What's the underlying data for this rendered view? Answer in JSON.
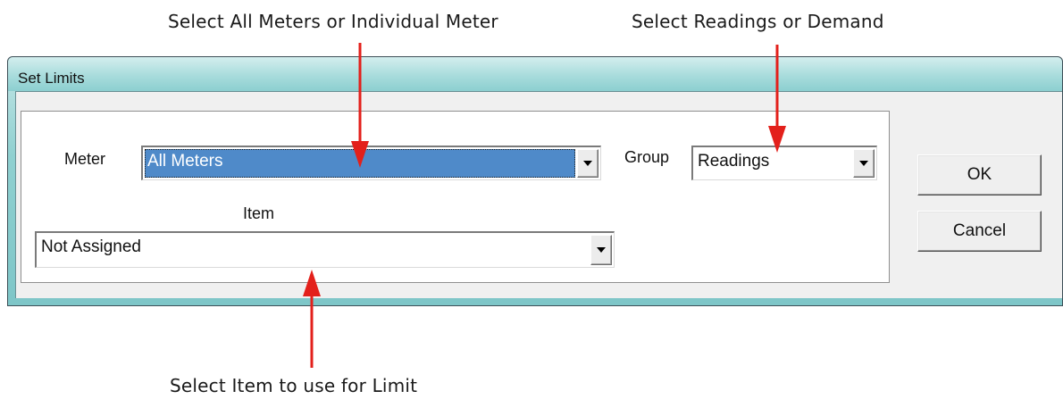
{
  "annotations": {
    "meter": "Select All Meters or Individual Meter",
    "group": "Select Readings or Demand",
    "item": "Select Item to use for Limit"
  },
  "window": {
    "title": "Set Limits"
  },
  "form": {
    "meter_label": "Meter",
    "meter_value": "All Meters",
    "group_label": "Group",
    "group_value": "Readings",
    "item_label": "Item",
    "item_value": "Not Assigned"
  },
  "buttons": {
    "ok": "OK",
    "cancel": "Cancel"
  },
  "colors": {
    "arrow": "#e3201b",
    "selection": "#4f8ac9",
    "titlebar": "#a8dcdc"
  },
  "icons": {
    "dropdown": "chevron-down-icon"
  }
}
